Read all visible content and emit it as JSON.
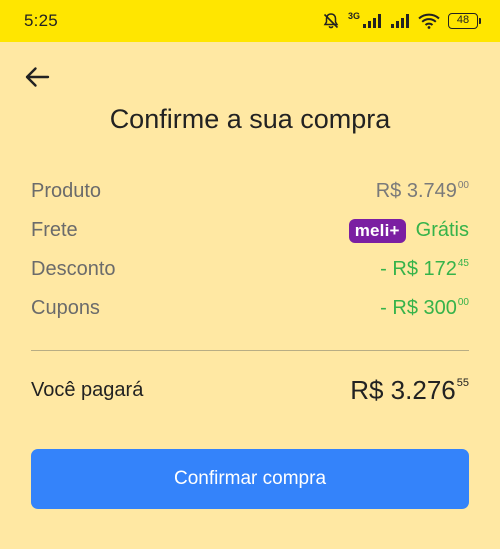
{
  "status_bar": {
    "time": "5:25",
    "network_label": "3G",
    "battery": "48",
    "icons": [
      "muted-bell-icon",
      "signal-icon",
      "signal-icon",
      "wifi-icon",
      "battery-icon"
    ]
  },
  "header": {
    "back_icon": "arrow-left-icon",
    "title": "Confirme a sua compra"
  },
  "summary": {
    "produto": {
      "label": "Produto",
      "value": "R$ 3.749",
      "cents": "00"
    },
    "frete": {
      "label": "Frete",
      "badge": "meli+",
      "value": "Grátis"
    },
    "desconto": {
      "label": "Desconto",
      "value": "- R$ 172",
      "cents": "45"
    },
    "cupons": {
      "label": "Cupons",
      "value": "- R$ 300",
      "cents": "00"
    }
  },
  "total": {
    "label": "Você pagará",
    "value": "R$ 3.276",
    "cents": "55"
  },
  "actions": {
    "confirm_label": "Confirmar compra"
  },
  "colors": {
    "status_bar": "#FFE600",
    "background": "#FFE8A3",
    "primary_button": "#3483FA",
    "discount_green": "#36B34A",
    "meli_badge": "#7B1FA2"
  }
}
